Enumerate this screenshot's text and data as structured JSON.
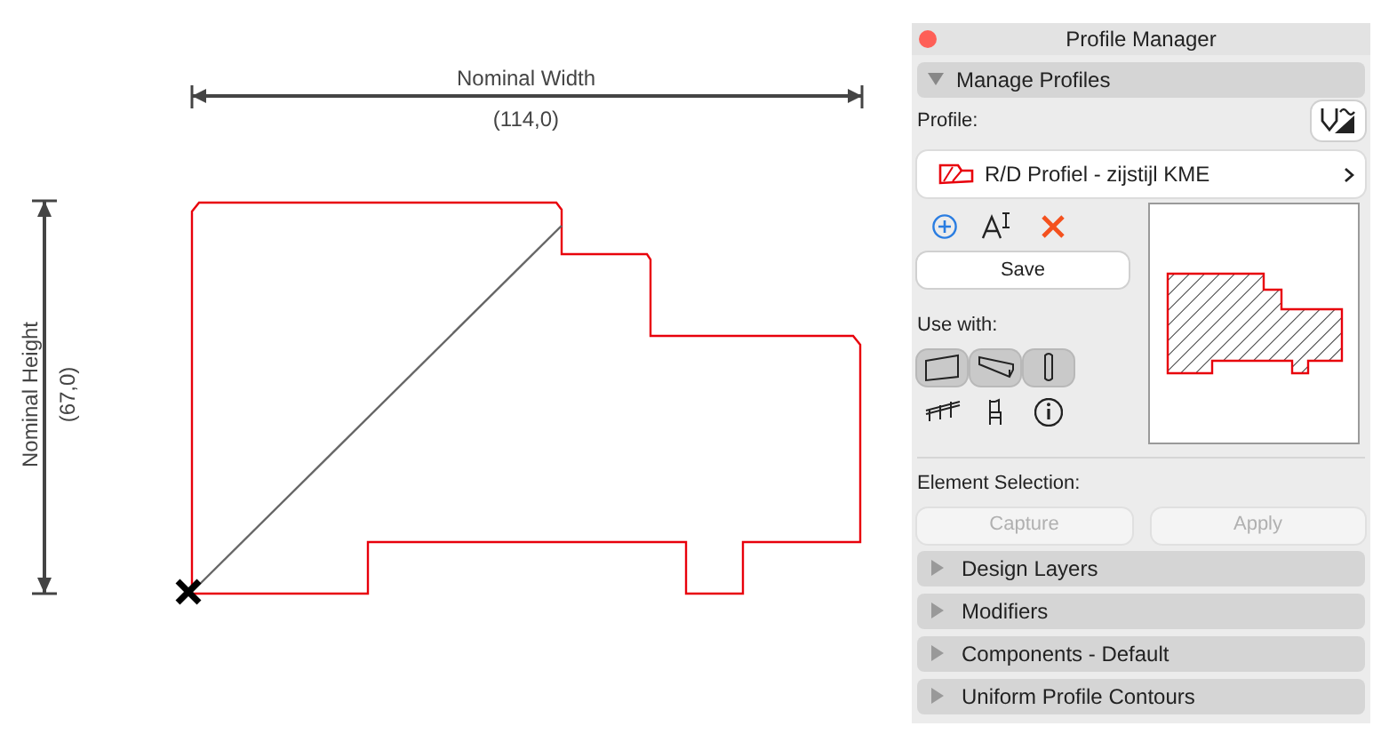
{
  "canvas": {
    "width_dimension": {
      "label": "Nominal Width",
      "value": "(114,0)"
    },
    "height_dimension": {
      "label": "Nominal Height",
      "value": "(67,0)"
    }
  },
  "panel": {
    "title": "Profile Manager",
    "manage_profiles": {
      "label": "Manage Profiles",
      "expanded": true
    },
    "profile_label": "Profile:",
    "profile_name": "R/D Profiel - zijstijl KME",
    "save_button": "Save",
    "use_with_label": "Use with:",
    "use_with": [
      {
        "kind": "wall",
        "selected": true
      },
      {
        "kind": "beam",
        "selected": true
      },
      {
        "kind": "column",
        "selected": true
      },
      {
        "kind": "railing",
        "selected": false
      },
      {
        "kind": "object",
        "selected": false
      },
      {
        "kind": "info",
        "selected": false
      }
    ],
    "element_selection_label": "Element Selection:",
    "selection_buttons": [
      {
        "label": "Capture",
        "disabled": true
      },
      {
        "label": "Apply",
        "disabled": true
      }
    ],
    "sections": [
      {
        "label": "Design Layers",
        "expanded": false
      },
      {
        "label": "Modifiers",
        "expanded": false
      },
      {
        "label": "Components - Default",
        "expanded": false
      },
      {
        "label": "Uniform Profile Contours",
        "expanded": false
      }
    ]
  }
}
